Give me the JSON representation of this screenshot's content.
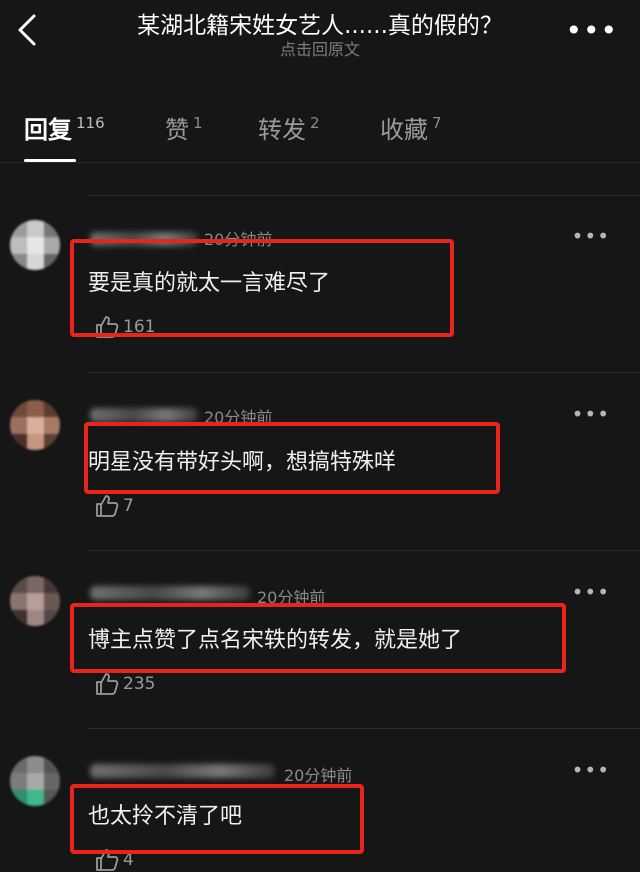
{
  "header": {
    "title": "某湖北籍宋姓女艺人......真的假的？",
    "subtitle": "点击回原文",
    "back_icon": "chevron-left-icon",
    "more_icon": "more-horizontal-icon"
  },
  "tabs": [
    {
      "label": "回复",
      "count": "116",
      "active": true
    },
    {
      "label": "赞",
      "count": "1",
      "active": false
    },
    {
      "label": "转发",
      "count": "2",
      "active": false
    },
    {
      "label": "收藏",
      "count": "7",
      "active": false
    }
  ],
  "comments": [
    {
      "time": "20分钟前",
      "text": "要是真的就太一言难尽了",
      "likes": "161"
    },
    {
      "time": "20分钟前",
      "text": "明星没有带好头啊，想搞特殊咩",
      "likes": "7"
    },
    {
      "time": "20分钟前",
      "text": "博主点赞了点名宋轶的转发，就是她了",
      "likes": "235"
    },
    {
      "time": "20分钟前",
      "text": "也太拎不清了吧",
      "likes": "4"
    }
  ],
  "colors": {
    "background": "#161616",
    "highlight_border": "#e8241d"
  }
}
